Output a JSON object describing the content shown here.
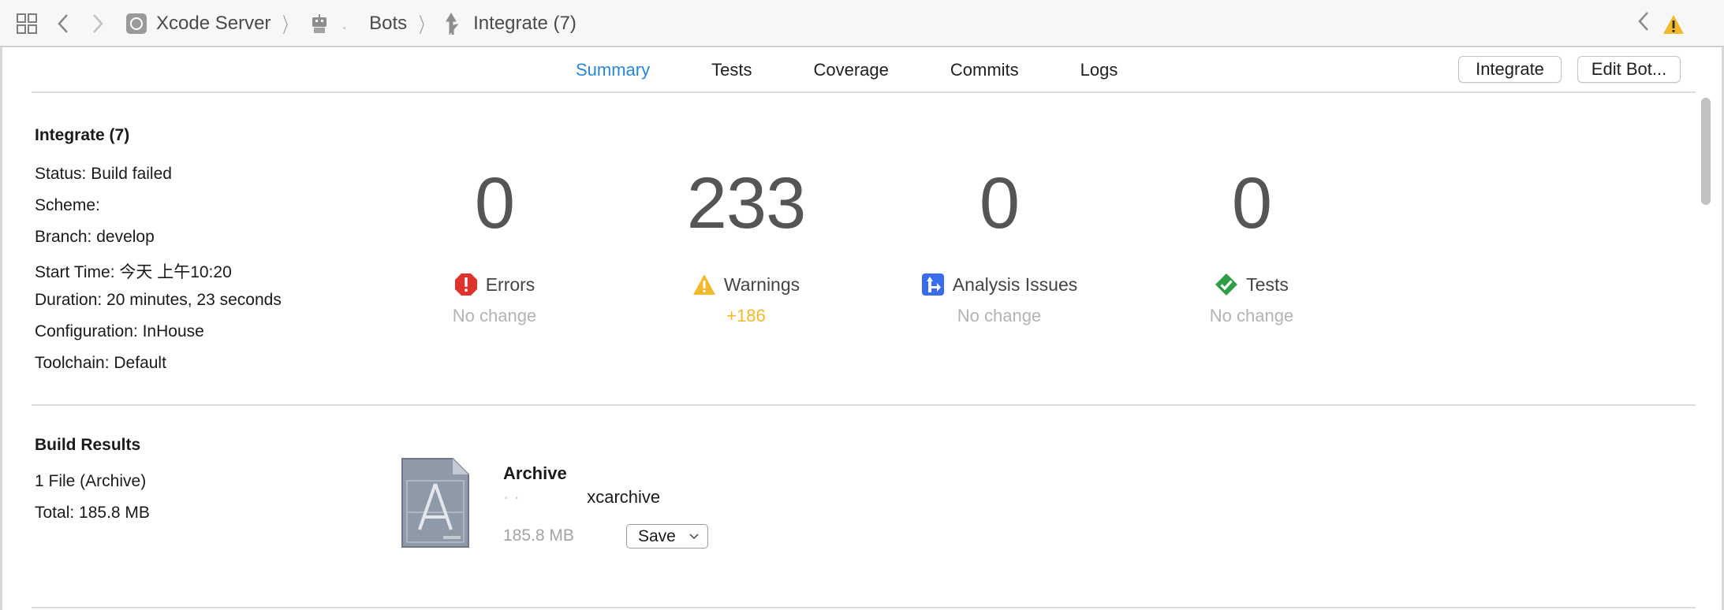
{
  "breadcrumb": {
    "server": "Xcode Server",
    "bots": "Bots",
    "integration": "Integrate (7)"
  },
  "tabs": [
    "Summary",
    "Tests",
    "Coverage",
    "Commits",
    "Logs"
  ],
  "buttons": {
    "integrate": "Integrate",
    "edit_bot": "Edit Bot..."
  },
  "summary": {
    "title": "Integrate (7)",
    "status": "Status: Build failed",
    "scheme": "Scheme:",
    "branch": "Branch: develop",
    "start_time": "Start Time: 今天 上午10:20",
    "duration": "Duration: 20 minutes, 23 seconds",
    "configuration": "Configuration: InHouse",
    "toolchain": "Toolchain: Default"
  },
  "metrics": {
    "errors": {
      "value": "0",
      "label": "Errors",
      "change": "No change"
    },
    "warnings": {
      "value": "233",
      "label": "Warnings",
      "change": "+186"
    },
    "analysis": {
      "value": "0",
      "label": "Analysis Issues",
      "change": "No change"
    },
    "tests": {
      "value": "0",
      "label": "Tests",
      "change": "No change"
    }
  },
  "build_results": {
    "title": "Build Results",
    "files": "1 File (Archive)",
    "total": "Total: 185.8 MB",
    "archive_title": "Archive",
    "archive_file": "xcarchive",
    "archive_size": "185.8 MB",
    "save_label": "Save"
  },
  "colors": {
    "accent": "#2b86d6",
    "error": "#e0322c",
    "warning": "#f2b92c",
    "analysis": "#3a6cf0",
    "success": "#2e9d45"
  }
}
